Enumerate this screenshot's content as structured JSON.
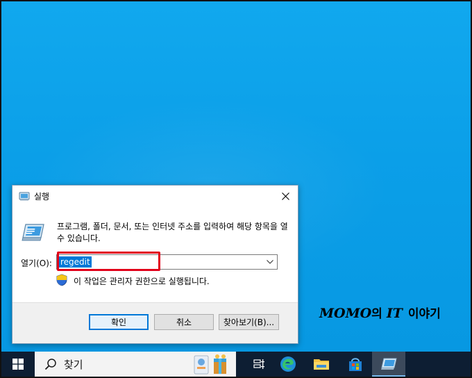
{
  "dialog": {
    "title": "실행",
    "description": "프로그램, 폴더, 문서, 또는 인터넷 주소를 입력하여 해당 항목을 열 수 있습니다.",
    "open_label": "열기(O):",
    "open_value": "regedit",
    "admin_note": "이 작업은 관리자 권한으로 실행됩니다.",
    "ok_label": "확인",
    "cancel_label": "취소",
    "browse_label": "찾아보기(B)..."
  },
  "watermark": {
    "brand": "MOMO",
    "possessive": "의",
    "it": "IT",
    "story": "이야기"
  },
  "taskbar": {
    "search_text": "찾기",
    "items": [
      "task-view",
      "edge",
      "file-explorer",
      "store",
      "run"
    ]
  },
  "colors": {
    "desktop": "#0aa0e8",
    "taskbar": "#0d1e33",
    "selection": "#0078d7",
    "highlight": "#e2001a"
  }
}
